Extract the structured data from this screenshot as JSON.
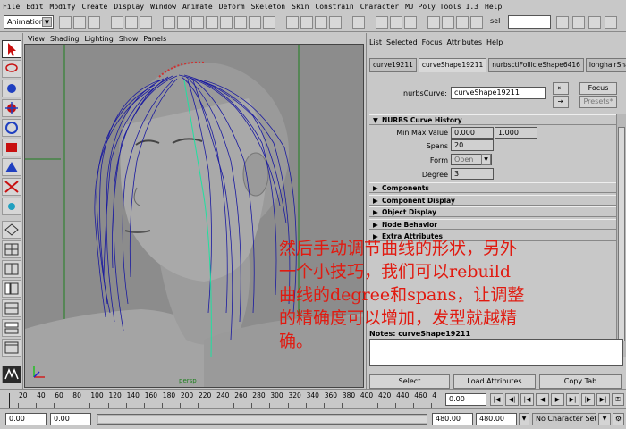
{
  "menubar": [
    "File",
    "Edit",
    "Modify",
    "Create",
    "Display",
    "Window",
    "Animate",
    "Deform",
    "Skeleton",
    "Skin",
    "Constrain",
    "Character",
    "MJ Poly Tools 1.3",
    "Help"
  ],
  "status": {
    "mode": "Animation",
    "sel_label": "sel"
  },
  "viewport_menu": [
    "View",
    "Shading",
    "Lighting",
    "Show",
    "Panels"
  ],
  "viewport": {
    "camera_label": "persp",
    "colors": {
      "background": "#8c8c8c",
      "curves": "#1a1aa0",
      "highlight_curve": "#20e0a0",
      "grid_lines": "#1f7f1f"
    }
  },
  "ae": {
    "menu": [
      "List",
      "Selected",
      "Focus",
      "Attributes",
      "Help"
    ],
    "tabs": [
      "curve19211",
      "curveShape19211",
      "nurbsctlFollicleShape6416",
      "longhairShape1"
    ],
    "active_tab": 1,
    "node_label": "nurbsCurve:",
    "node_value": "curveShape19211",
    "focus_btn": "Focus",
    "presets_btn": "Presets*",
    "history_title": "NURBS Curve History",
    "minmax_label": "Min Max Value",
    "min_value": "0.000",
    "max_value": "1.000",
    "spans_label": "Spans",
    "spans_value": "20",
    "form_label": "Form",
    "form_value": "Open",
    "degree_label": "Degree",
    "degree_value": "3",
    "sections": [
      "Components",
      "Component Display",
      "Object Display",
      "Node Behavior",
      "Extra Attributes"
    ],
    "notes_label": "Notes: curveShape19211",
    "bottom_buttons": [
      "Select",
      "Load Attributes",
      "Copy Tab"
    ]
  },
  "timeline": {
    "ticks": [
      "20",
      "40",
      "60",
      "80",
      "100",
      "120",
      "140",
      "160",
      "180",
      "200",
      "220",
      "240",
      "260",
      "280",
      "300",
      "320",
      "340",
      "360",
      "380",
      "400",
      "420",
      "440",
      "460",
      "4"
    ],
    "current_frame": "0.00"
  },
  "range": {
    "start": "0.00",
    "start2": "0.00",
    "end": "480.00",
    "end2": "480.00",
    "character_set": "No Character Set"
  },
  "annotation": {
    "line1": "然后手动调节曲线的形状，另外",
    "line2": "一个小技巧，我们可以rebuild",
    "line3": "曲线的degree和spans，让调整",
    "line4": "的精确度可以增加，发型就越精",
    "line5": "确。",
    "color": "#e11a10"
  }
}
